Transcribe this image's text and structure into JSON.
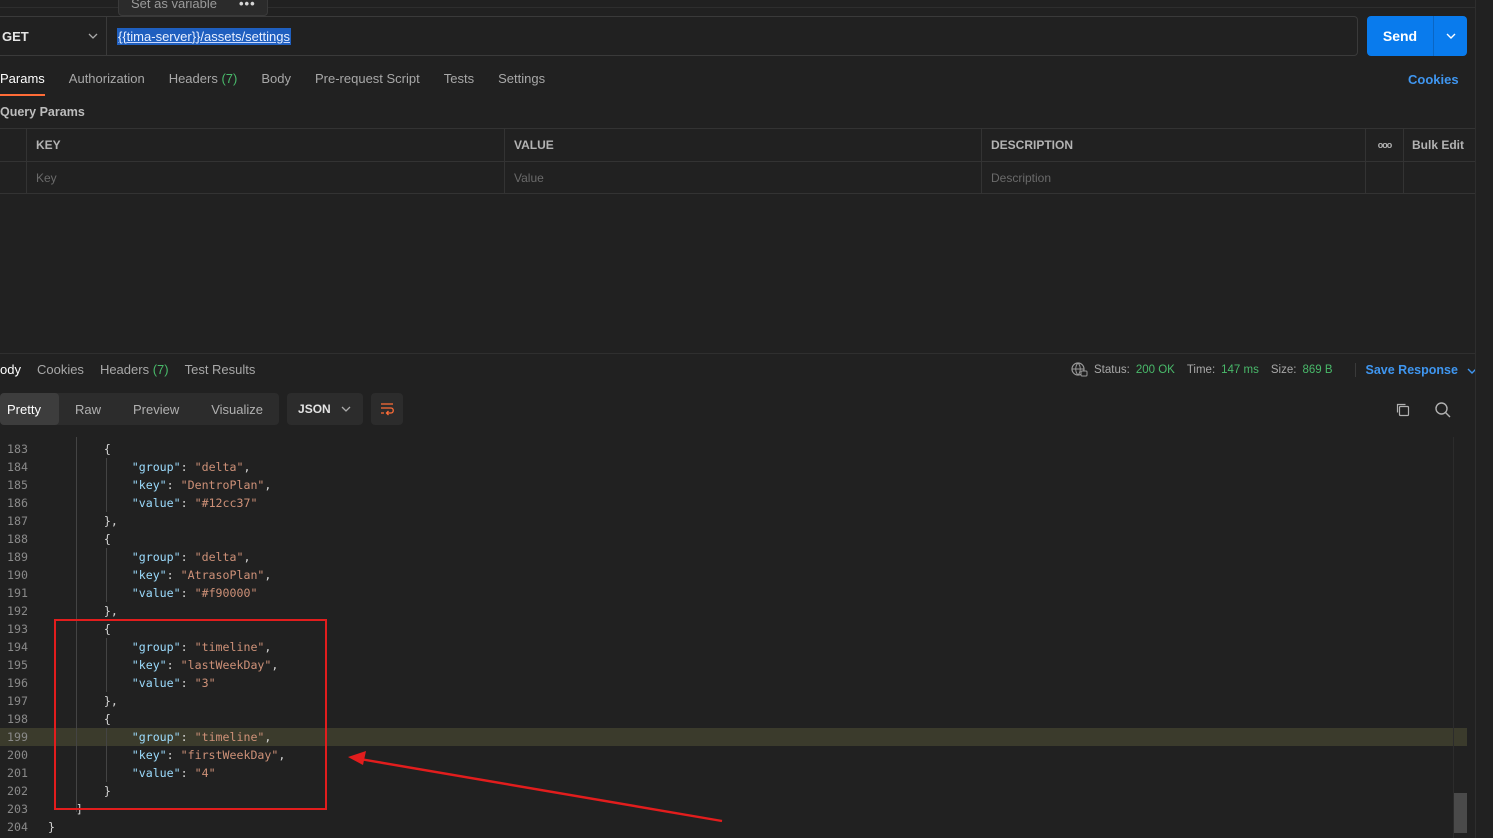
{
  "tooltip": {
    "label": "Set as variable",
    "more": "•••"
  },
  "request": {
    "method": "GET",
    "url": "{{tima-server}}/assets/settings",
    "send_label": "Send"
  },
  "request_tabs": {
    "params": "Params",
    "authorization": "Authorization",
    "headers": "Headers",
    "headers_count": "(7)",
    "body": "Body",
    "pre_request": "Pre-request Script",
    "tests": "Tests",
    "settings": "Settings",
    "cookies": "Cookies"
  },
  "query_params": {
    "title": "Query Params",
    "columns": {
      "key": "KEY",
      "value": "VALUE",
      "description": "DESCRIPTION",
      "more": "ooo",
      "bulk_edit": "Bulk Edit"
    },
    "placeholders": {
      "key": "Key",
      "value": "Value",
      "description": "Description"
    }
  },
  "response_tabs": {
    "body": "ody",
    "cookies": "Cookies",
    "headers": "Headers",
    "headers_count": "(7)",
    "test_results": "Test Results"
  },
  "response_status": {
    "status_label": "Status:",
    "status_value": "200 OK",
    "time_label": "Time:",
    "time_value": "147 ms",
    "size_label": "Size:",
    "size_value": "869 B",
    "save_response": "Save Response"
  },
  "view_modes": {
    "pretty": "Pretty",
    "raw": "Raw",
    "preview": "Preview",
    "visualize": "Visualize",
    "format": "JSON"
  },
  "code_lines": [
    {
      "num": "183",
      "indent": "        ",
      "parts": [
        [
          "p",
          "{"
        ]
      ]
    },
    {
      "num": "184",
      "indent": "            ",
      "parts": [
        [
          "k",
          "\"group\""
        ],
        [
          "p",
          ": "
        ],
        [
          "s",
          "\"delta\""
        ],
        [
          "p",
          ","
        ]
      ]
    },
    {
      "num": "185",
      "indent": "            ",
      "parts": [
        [
          "k",
          "\"key\""
        ],
        [
          "p",
          ": "
        ],
        [
          "s",
          "\"DentroPlan\""
        ],
        [
          "p",
          ","
        ]
      ]
    },
    {
      "num": "186",
      "indent": "            ",
      "parts": [
        [
          "k",
          "\"value\""
        ],
        [
          "p",
          ": "
        ],
        [
          "s",
          "\"#12cc37\""
        ]
      ]
    },
    {
      "num": "187",
      "indent": "        ",
      "parts": [
        [
          "p",
          "},"
        ]
      ]
    },
    {
      "num": "188",
      "indent": "        ",
      "parts": [
        [
          "p",
          "{"
        ]
      ]
    },
    {
      "num": "189",
      "indent": "            ",
      "parts": [
        [
          "k",
          "\"group\""
        ],
        [
          "p",
          ": "
        ],
        [
          "s",
          "\"delta\""
        ],
        [
          "p",
          ","
        ]
      ]
    },
    {
      "num": "190",
      "indent": "            ",
      "parts": [
        [
          "k",
          "\"key\""
        ],
        [
          "p",
          ": "
        ],
        [
          "s",
          "\"AtrasoPlan\""
        ],
        [
          "p",
          ","
        ]
      ]
    },
    {
      "num": "191",
      "indent": "            ",
      "parts": [
        [
          "k",
          "\"value\""
        ],
        [
          "p",
          ": "
        ],
        [
          "s",
          "\"#f90000\""
        ]
      ]
    },
    {
      "num": "192",
      "indent": "        ",
      "parts": [
        [
          "p",
          "},"
        ]
      ]
    },
    {
      "num": "193",
      "indent": "        ",
      "parts": [
        [
          "p",
          "{"
        ]
      ]
    },
    {
      "num": "194",
      "indent": "            ",
      "parts": [
        [
          "k",
          "\"group\""
        ],
        [
          "p",
          ": "
        ],
        [
          "s",
          "\"timeline\""
        ],
        [
          "p",
          ","
        ]
      ]
    },
    {
      "num": "195",
      "indent": "            ",
      "parts": [
        [
          "k",
          "\"key\""
        ],
        [
          "p",
          ": "
        ],
        [
          "s",
          "\"lastWeekDay\""
        ],
        [
          "p",
          ","
        ]
      ]
    },
    {
      "num": "196",
      "indent": "            ",
      "parts": [
        [
          "k",
          "\"value\""
        ],
        [
          "p",
          ": "
        ],
        [
          "s",
          "\"3\""
        ]
      ]
    },
    {
      "num": "197",
      "indent": "        ",
      "parts": [
        [
          "p",
          "},"
        ]
      ]
    },
    {
      "num": "198",
      "indent": "        ",
      "parts": [
        [
          "p",
          "{"
        ]
      ]
    },
    {
      "num": "199",
      "indent": "            ",
      "parts": [
        [
          "k",
          "\"group\""
        ],
        [
          "p",
          ": "
        ],
        [
          "s",
          "\"timeline\""
        ],
        [
          "p",
          ","
        ]
      ],
      "highlight": true
    },
    {
      "num": "200",
      "indent": "            ",
      "parts": [
        [
          "k",
          "\"key\""
        ],
        [
          "p",
          ": "
        ],
        [
          "s",
          "\"firstWeekDay\""
        ],
        [
          "p",
          ","
        ]
      ]
    },
    {
      "num": "201",
      "indent": "            ",
      "parts": [
        [
          "k",
          "\"value\""
        ],
        [
          "p",
          ": "
        ],
        [
          "s",
          "\"4\""
        ]
      ]
    },
    {
      "num": "202",
      "indent": "        ",
      "parts": [
        [
          "p",
          "}"
        ]
      ]
    },
    {
      "num": "203",
      "indent": "    ",
      "parts": [
        [
          "p",
          "]"
        ]
      ]
    },
    {
      "num": "204",
      "indent": "",
      "parts": [
        [
          "p",
          "}"
        ]
      ]
    }
  ],
  "colors": {
    "accent": "#ff6c37",
    "primary": "#097bed",
    "link": "#3f96f0",
    "success": "#49b96a",
    "annotation": "#e21d1d"
  }
}
